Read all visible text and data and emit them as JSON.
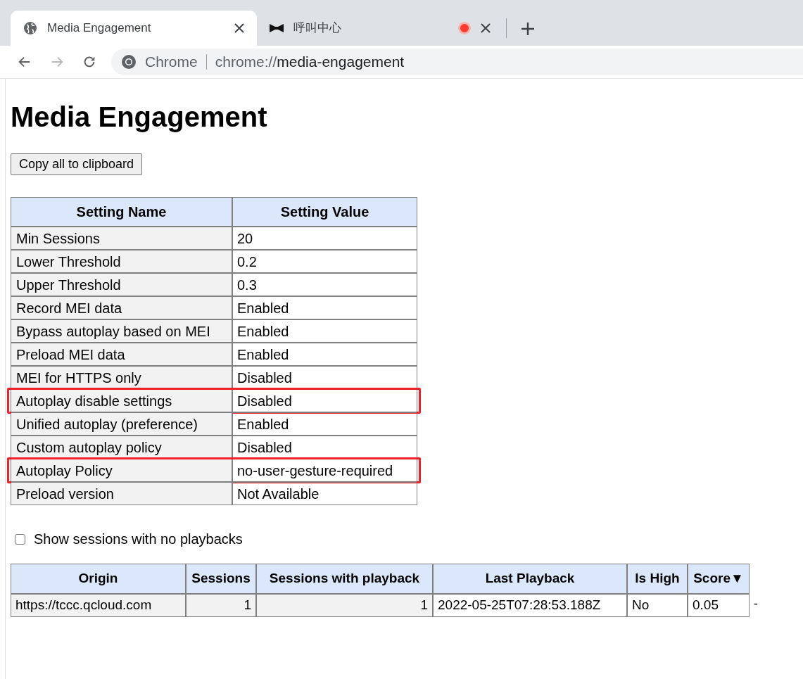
{
  "tabs": [
    {
      "title": "Media Engagement",
      "selected": true,
      "recording": false
    },
    {
      "title": "呼叫中心",
      "selected": false,
      "recording": true
    }
  ],
  "address_bar": {
    "site_label": "Chrome",
    "scheme": "chrome://",
    "path": "media-engagement"
  },
  "page_title": "Media Engagement",
  "copy_button": "Copy all to clipboard",
  "settings_table": {
    "columns": [
      "Setting Name",
      "Setting Value"
    ],
    "rows": [
      {
        "name": "Min Sessions",
        "value": "20",
        "highlighted": false
      },
      {
        "name": "Lower Threshold",
        "value": "0.2",
        "highlighted": false
      },
      {
        "name": "Upper Threshold",
        "value": "0.3",
        "highlighted": false
      },
      {
        "name": "Record MEI data",
        "value": "Enabled",
        "highlighted": false
      },
      {
        "name": "Bypass autoplay based on MEI",
        "value": "Enabled",
        "highlighted": false
      },
      {
        "name": "Preload MEI data",
        "value": "Enabled",
        "highlighted": false
      },
      {
        "name": "MEI for HTTPS only",
        "value": "Disabled",
        "highlighted": false
      },
      {
        "name": "Autoplay disable settings",
        "value": "Disabled",
        "highlighted": true
      },
      {
        "name": "Unified autoplay (preference)",
        "value": "Enabled",
        "highlighted": false
      },
      {
        "name": "Custom autoplay policy",
        "value": "Disabled",
        "highlighted": false
      },
      {
        "name": "Autoplay Policy",
        "value": "no-user-gesture-required",
        "highlighted": true
      },
      {
        "name": "Preload version",
        "value": "Not Available",
        "highlighted": false
      }
    ]
  },
  "show_no_playbacks": {
    "label": "Show sessions with no playbacks",
    "checked": false
  },
  "sessions_table": {
    "columns": [
      "Origin",
      "Sessions",
      "Sessions with playback",
      "Last Playback",
      "Is High",
      "Score▼"
    ],
    "rows": [
      {
        "cells": [
          "https://tccc.qcloud.com",
          "1",
          "1",
          "2022-05-25T07:28:53.188Z",
          "No",
          "0.05"
        ],
        "trailing": "-"
      }
    ]
  }
}
